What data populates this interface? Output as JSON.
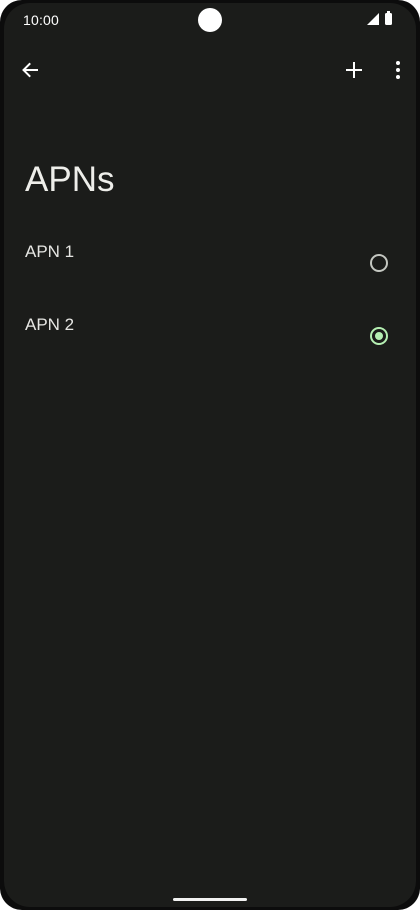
{
  "status_bar": {
    "time": "10:00",
    "icons": [
      "signal-icon",
      "battery-icon"
    ]
  },
  "toolbar": {
    "icons": [
      "arrow-back-icon",
      "add-icon",
      "more-vert-icon"
    ]
  },
  "page": {
    "title": "APNs"
  },
  "apns": [
    {
      "label": "APN 1",
      "selected": false
    },
    {
      "label": "APN 2",
      "selected": true
    }
  ],
  "colors": {
    "background": "#1b1c1a",
    "text": "#e6e6e3",
    "radio_unchecked": "#c4c7c1",
    "radio_checked": "#b5efb2"
  }
}
